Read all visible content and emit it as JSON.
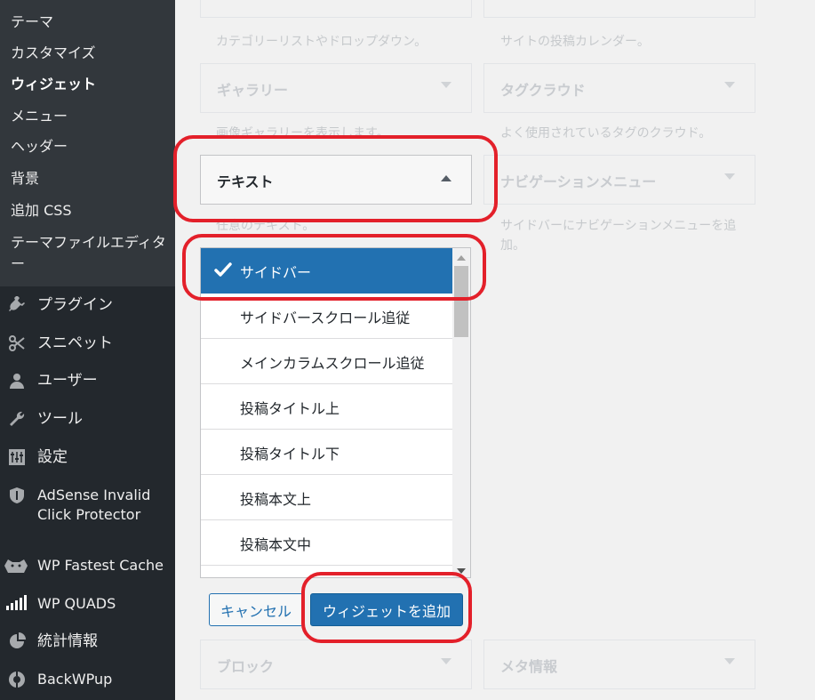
{
  "sidebar": {
    "submenu": [
      {
        "label": "テーマ",
        "current": false
      },
      {
        "label": "カスタマイズ",
        "current": false
      },
      {
        "label": "ウィジェット",
        "current": true
      },
      {
        "label": "メニュー",
        "current": false
      },
      {
        "label": "ヘッダー",
        "current": false
      },
      {
        "label": "背景",
        "current": false
      },
      {
        "label": "追加 CSS",
        "current": false
      },
      {
        "label": "テーマファイルエディター",
        "current": false
      }
    ],
    "menu": [
      {
        "label": "プラグイン",
        "icon": "plugin-icon"
      },
      {
        "label": "スニペット",
        "icon": "scissors-icon"
      },
      {
        "label": "ユーザー",
        "icon": "user-icon"
      },
      {
        "label": "ツール",
        "icon": "wrench-icon"
      },
      {
        "label": "設定",
        "icon": "settings-icon"
      },
      {
        "label": "AdSense Invalid Click Protector",
        "icon": "shield-icon"
      },
      {
        "label": "WP Fastest Cache",
        "icon": "cheetah-icon"
      },
      {
        "label": "WP QUADS",
        "icon": "signal-bars-icon"
      },
      {
        "label": "統計情報",
        "icon": "pie-chart-icon"
      },
      {
        "label": "BackWPup",
        "icon": "backwpup-icon"
      }
    ]
  },
  "widgets": {
    "row0_desc_left": "カテゴリーリストやドロップダウン。",
    "row0_desc_right": "サイトの投稿カレンダー。",
    "gallery_title": "ギャラリー",
    "gallery_desc": "画像ギャラリーを表示します。",
    "tagcloud_title": "タグクラウド",
    "tagcloud_desc": "よく使用されているタグのクラウド。",
    "text_title": "テキスト",
    "text_desc": "任意のテキスト。",
    "navmenu_title": "ナビゲーションメニュー",
    "navmenu_desc": "サイドバーにナビゲーションメニューを追加。",
    "block_title": "ブロック",
    "meta_title": "メタ情報"
  },
  "sidebar_choices": {
    "items": [
      "サイドバー",
      "サイドバースクロール追従",
      "メインカラムスクロール追従",
      "投稿タイトル上",
      "投稿タイトル下",
      "投稿本文上",
      "投稿本文中"
    ],
    "selected_index": 0
  },
  "buttons": {
    "cancel": "キャンセル",
    "add_widget": "ウィジェットを追加"
  },
  "colors": {
    "accent": "#2271b1",
    "annotation": "#e3202a",
    "sidebar_bg": "#23282d"
  }
}
